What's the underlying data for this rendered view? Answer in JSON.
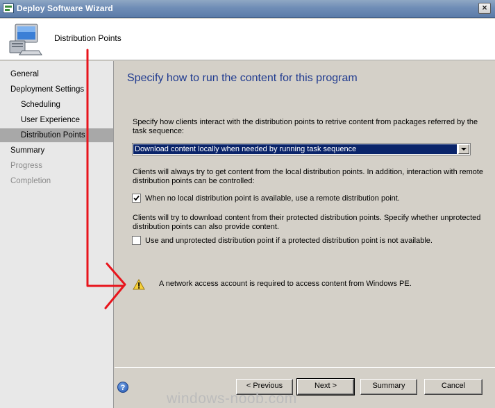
{
  "window": {
    "title": "Deploy Software Wizard",
    "close_glyph": "×"
  },
  "header": {
    "title": "Distribution Points",
    "icon": "computer-icon"
  },
  "sidebar": {
    "items": [
      {
        "label": "General",
        "state": "normal"
      },
      {
        "label": "Deployment Settings",
        "state": "normal"
      },
      {
        "label": "Scheduling",
        "state": "normal"
      },
      {
        "label": "User Experience",
        "state": "normal"
      },
      {
        "label": "Distribution Points",
        "state": "selected"
      },
      {
        "label": "Summary",
        "state": "normal"
      },
      {
        "label": "Progress",
        "state": "disabled"
      },
      {
        "label": "Completion",
        "state": "disabled"
      }
    ]
  },
  "main": {
    "heading": "Specify how to run the content for this program",
    "interaction_text_line1": "Specify how clients interact with the distribution points to retrive content from packages referred by the",
    "interaction_text_line2": "task sequence:",
    "deployment_option": {
      "selected": "Download content locally when needed by running task sequence"
    },
    "clients_text_line1": "Clients will always try to get content from the local distribution points. In addition, interaction with remote",
    "clients_text_line2": "distribution points can be controlled:",
    "remote_dp": {
      "checked": true,
      "label": "When no local distribution point is available, use a remote distribution point."
    },
    "protected_text_line1": "Clients will try to download content from their protected distribution points. Specify whether unprotected",
    "protected_text_line2": "distribution points can also provide content.",
    "unprotected_dp": {
      "checked": false,
      "label": "Use and unprotected distribution point if a protected distribution point is not available."
    },
    "warning": "A network access account is required to access content from Windows PE."
  },
  "footer": {
    "previous_label": "< Previous",
    "next_label": "Next >",
    "summary_label": "Summary",
    "cancel_label": "Cancel"
  },
  "watermark": "windows-noob.com",
  "colors": {
    "heading": "#1f3a8f",
    "selection": "#0a246a",
    "annotation_arrow": "#e8141c"
  }
}
